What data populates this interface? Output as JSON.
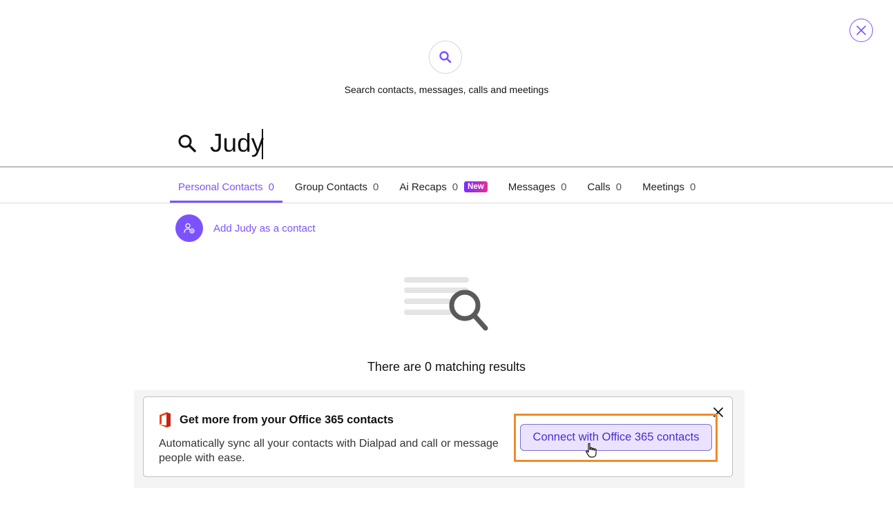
{
  "header": {
    "close_icon": "close-icon",
    "hero_icon": "search-icon",
    "hero_text": "Search contacts, messages, calls and meetings"
  },
  "search": {
    "value": "Judy",
    "icon": "search-icon"
  },
  "tabs": [
    {
      "label": "Personal Contacts",
      "count": "0",
      "active": true
    },
    {
      "label": "Group Contacts",
      "count": "0"
    },
    {
      "label": "Ai Recaps",
      "count": "0",
      "badge": "New"
    },
    {
      "label": "Messages",
      "count": "0"
    },
    {
      "label": "Calls",
      "count": "0"
    },
    {
      "label": "Meetings",
      "count": "0"
    }
  ],
  "add_contact": {
    "label": "Add Judy as a contact",
    "icon": "add-person-icon"
  },
  "empty_state": {
    "icon": "no-results-icon",
    "text": "There are 0 matching results"
  },
  "promo": {
    "logo": "office-logo-icon",
    "title": "Get more from your Office 365 contacts",
    "body": "Automatically sync all your contacts with Dialpad and call or message people with ease.",
    "button_label": "Connect with Office 365 contacts",
    "close_icon": "close-icon"
  },
  "colors": {
    "accent": "#7c52ff",
    "highlight": "#f08a2e",
    "badge_gradient": [
      "#7b2bff",
      "#e0309a"
    ]
  }
}
